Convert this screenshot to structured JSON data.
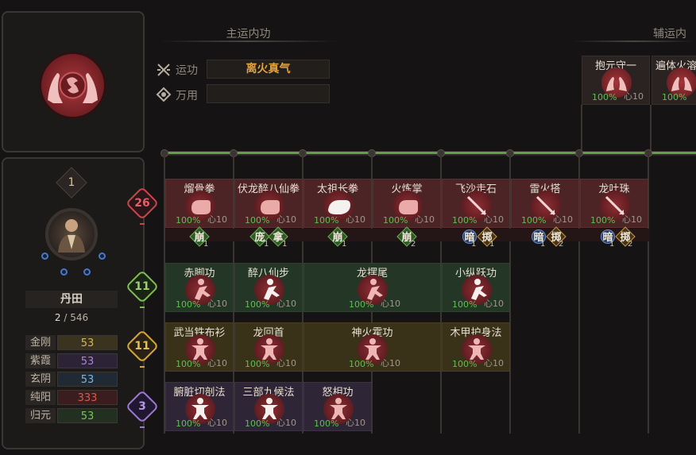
{
  "left": {
    "level": "1",
    "dantian": {
      "label": "丹田",
      "current": "2",
      "total": "/ 546"
    },
    "stats": [
      {
        "name": "金刚",
        "value": "53",
        "color": "#d4b65a"
      },
      {
        "name": "紫霞",
        "value": "53",
        "color": "#b184d6"
      },
      {
        "name": "玄阴",
        "value": "53",
        "color": "#7fb5e0"
      },
      {
        "name": "纯阳",
        "value": "333",
        "color": "#e05550"
      },
      {
        "name": "归元",
        "value": "53",
        "color": "#7fc25e"
      }
    ]
  },
  "main_section": {
    "title": "主运内功",
    "slot1_label": "运功",
    "slot1_value": "离火真气",
    "slot2_label": "万用",
    "slot2_value": ""
  },
  "aux_section": {
    "title": "辅运内",
    "items": [
      {
        "name": "抱元守一",
        "pct": "100%",
        "heart": "心10"
      },
      {
        "name": "遍体火溶",
        "pct": "100%",
        "heart": ""
      }
    ]
  },
  "tiers": [
    {
      "value": "26",
      "color": "#c8454c"
    },
    {
      "value": "11",
      "color": "#7cbd52"
    },
    {
      "value": "11",
      "color": "#d6a63a"
    },
    {
      "value": "3",
      "color": "#9c78d0"
    }
  ],
  "row1": [
    {
      "name": "熘骨拳",
      "pct": "100%",
      "heart": "心10",
      "tags": [
        {
          "t": "崩",
          "n": "1"
        }
      ]
    },
    {
      "name": "伏龙醉八仙拳",
      "pct": "100%",
      "heart": "心10",
      "tags": [
        {
          "t": "庞",
          "n": "1"
        },
        {
          "t": "拿",
          "n": "1"
        }
      ]
    },
    {
      "name": "太祖长拳",
      "pct": "100%",
      "heart": "心10",
      "tags": [
        {
          "t": "崩",
          "n": "1"
        }
      ]
    },
    {
      "name": "火炼掌",
      "pct": "100%",
      "heart": "心10",
      "tags": [
        {
          "t": "崩",
          "n": "2"
        }
      ]
    },
    {
      "name": "飞沙走石",
      "pct": "100%",
      "heart": "心10",
      "tags": [
        {
          "t": "暗",
          "n": "1"
        },
        {
          "t": "掷",
          "n": "1"
        }
      ]
    },
    {
      "name": "雷火搭",
      "pct": "100%",
      "heart": "心10",
      "tags": [
        {
          "t": "暗",
          "n": "1"
        },
        {
          "t": "掷",
          "n": "2"
        }
      ]
    },
    {
      "name": "龙吐珠",
      "pct": "100%",
      "heart": "心10",
      "tags": [
        {
          "t": "暗",
          "n": "1"
        },
        {
          "t": "掷",
          "n": "2"
        }
      ]
    }
  ],
  "row2": [
    {
      "name": "赤脚功",
      "pct": "100%",
      "heart": "心10"
    },
    {
      "name": "醉八仙步",
      "pct": "100%",
      "heart": "心10"
    },
    {
      "name": "龙摆尾",
      "pct": "100%",
      "heart": "心10"
    },
    {
      "name": "小纵跃功",
      "pct": "100%",
      "heart": "心10"
    }
  ],
  "row3": [
    {
      "name": "武当铁布衫",
      "pct": "100%",
      "heart": "心10"
    },
    {
      "name": "龙回首",
      "pct": "100%",
      "heart": "心10"
    },
    {
      "name": "神火霍功",
      "pct": "100%",
      "heart": "心10"
    },
    {
      "name": "木甲护身法",
      "pct": "100%",
      "heart": "心10"
    }
  ],
  "row4": [
    {
      "name": "腑脏切剖法",
      "pct": "100%",
      "heart": "心10"
    },
    {
      "name": "三部九候法",
      "pct": "100%",
      "heart": "心10"
    },
    {
      "name": "怒相功",
      "pct": "100%",
      "heart": "心10"
    }
  ],
  "icons": {
    "emblem": "praying-hands-icon",
    "avatar": "monk-portrait-icon"
  }
}
